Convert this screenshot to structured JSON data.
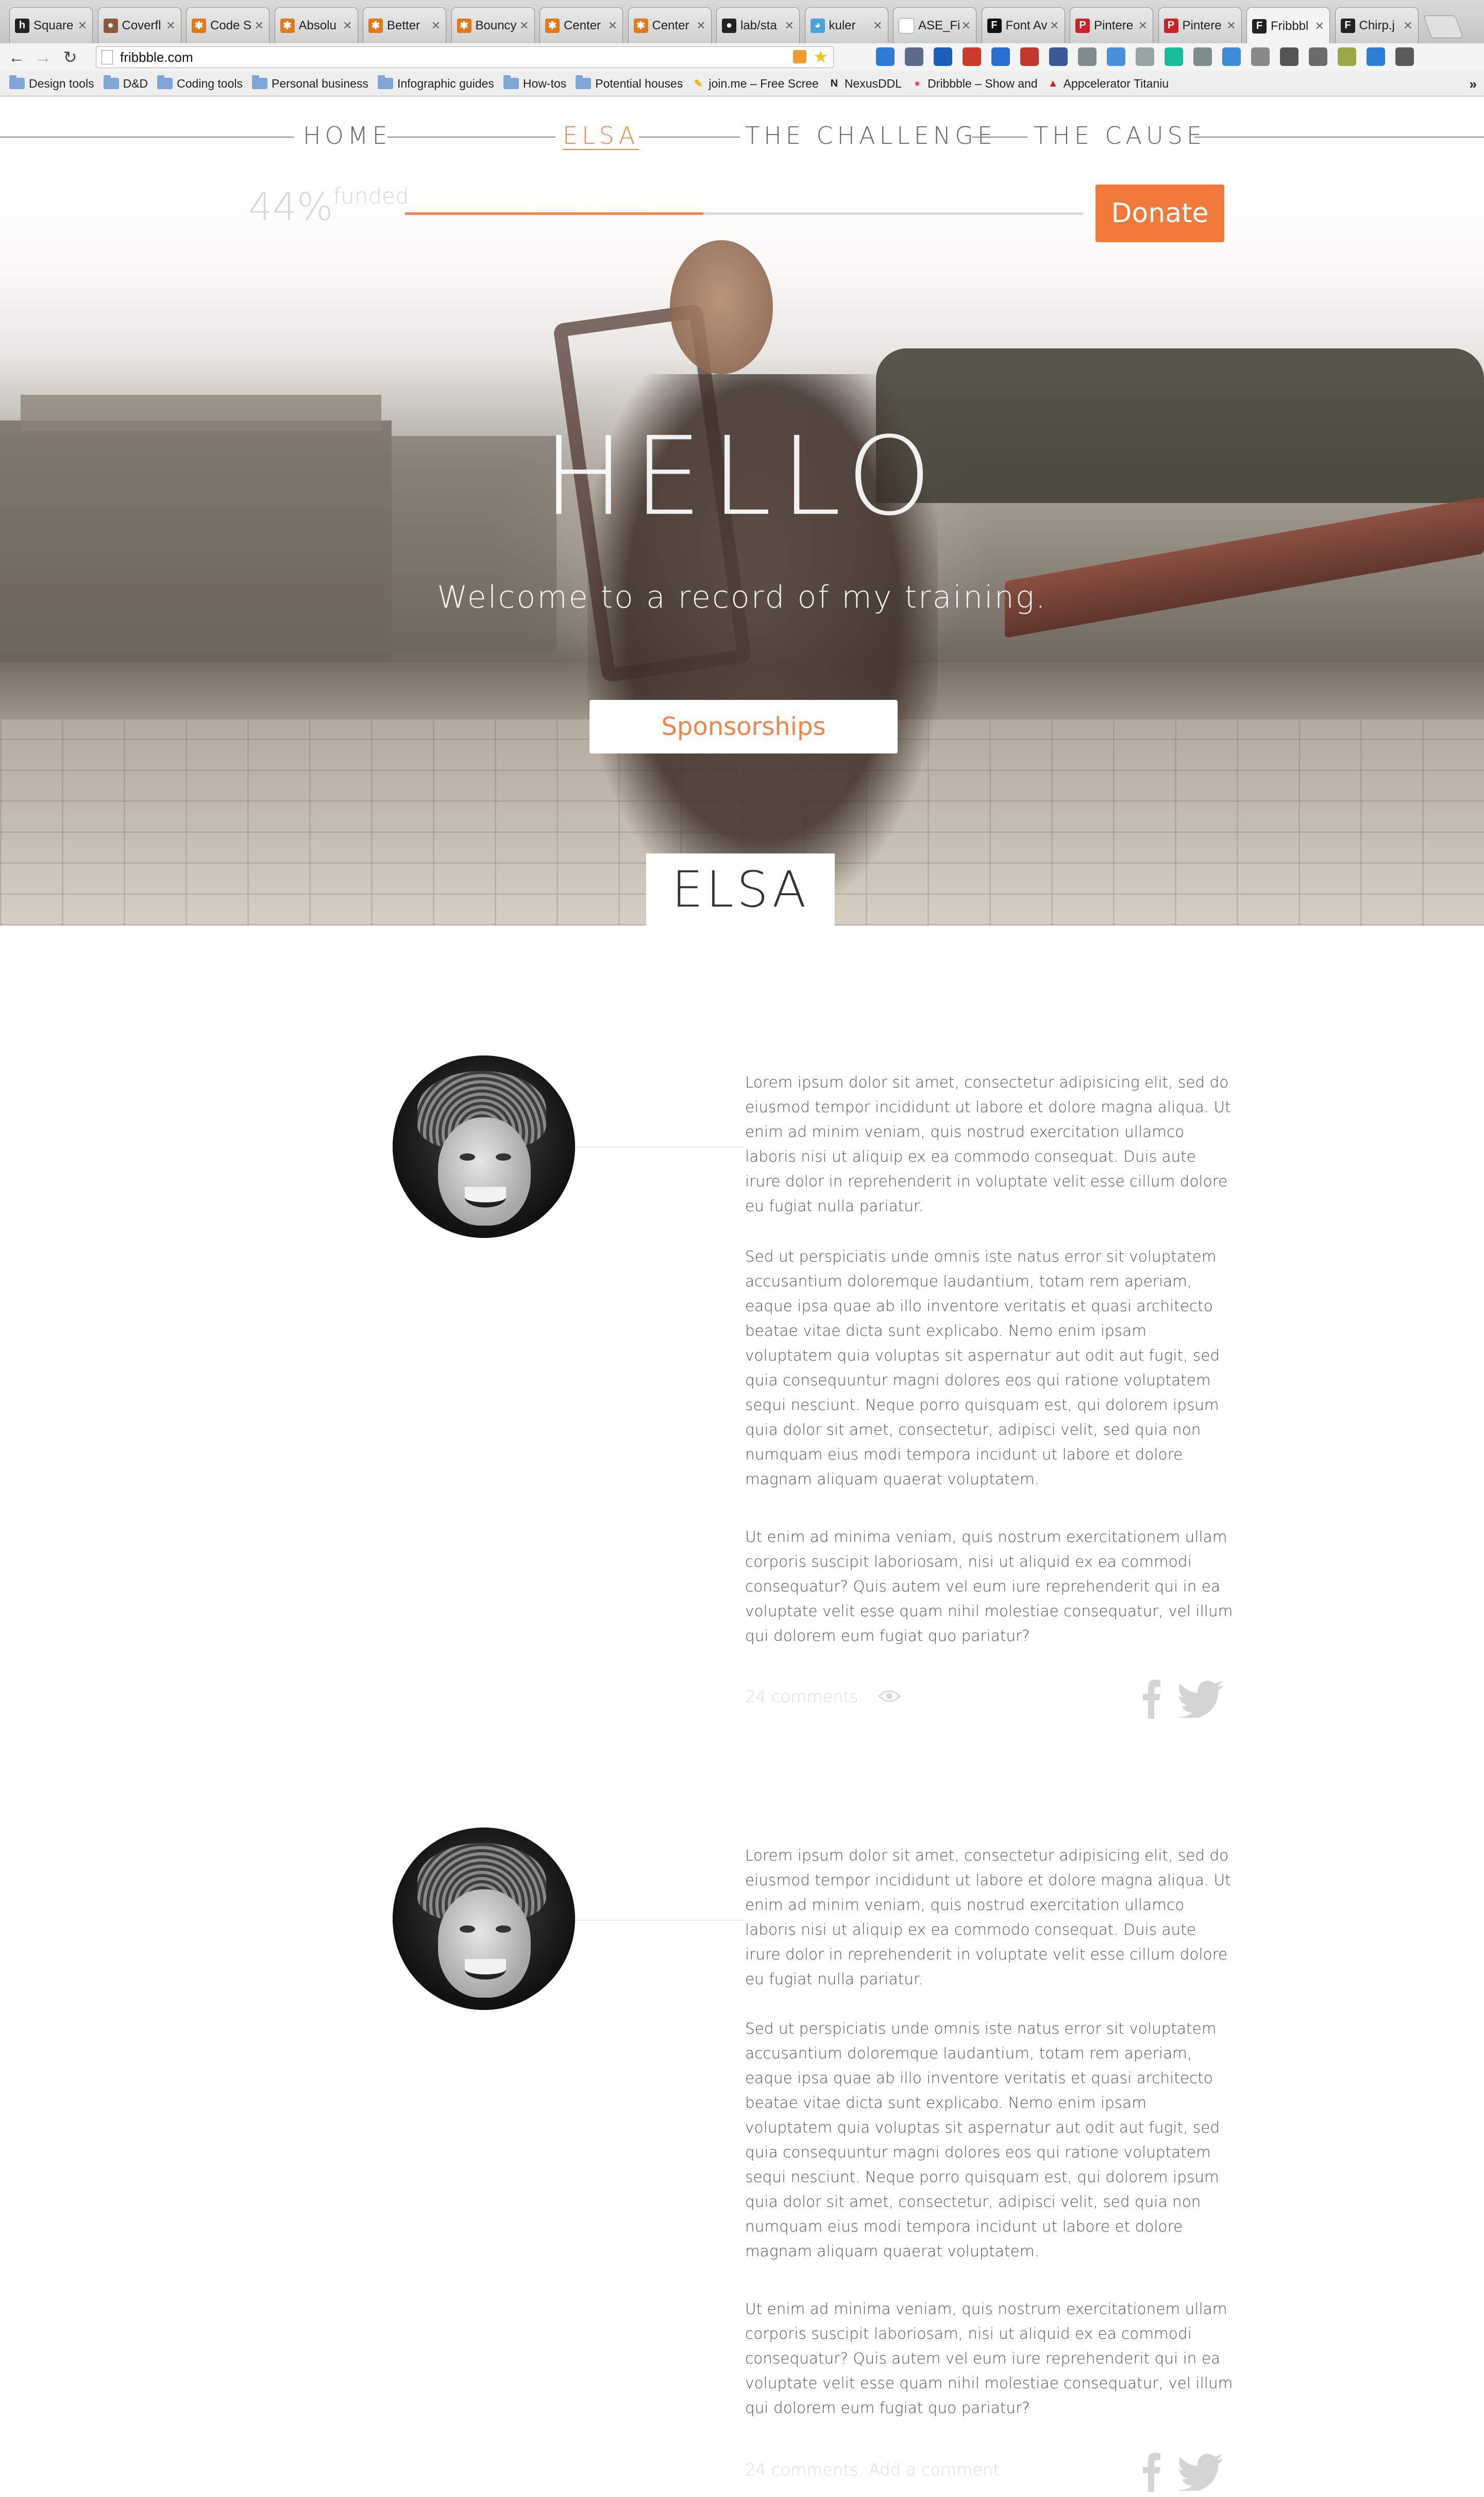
{
  "browser": {
    "tabs": [
      {
        "label": "Square",
        "icon": "h-icon",
        "color": "#222222"
      },
      {
        "label": "Coverfl",
        "icon": "avatar-icon",
        "color": "#8a5a3a"
      },
      {
        "label": "Code S",
        "icon": "asterisk-icon",
        "color": "#e07a1a"
      },
      {
        "label": "Absolu",
        "icon": "asterisk-icon",
        "color": "#e07a1a"
      },
      {
        "label": "Better",
        "icon": "asterisk-icon",
        "color": "#e07a1a"
      },
      {
        "label": "Bouncy",
        "icon": "asterisk-icon",
        "color": "#e07a1a"
      },
      {
        "label": "Center",
        "icon": "asterisk-icon",
        "color": "#e07a1a"
      },
      {
        "label": "Center",
        "icon": "asterisk-icon",
        "color": "#e07a1a"
      },
      {
        "label": "lab/sta",
        "icon": "github-icon",
        "color": "#222222"
      },
      {
        "label": "kuler",
        "icon": "kuler-icon",
        "color": "#4aa3df"
      },
      {
        "label": "ASE_Fil",
        "icon": "page-icon",
        "color": "#ffffff"
      },
      {
        "label": "Font Av",
        "icon": "font-icon",
        "color": "#111111"
      },
      {
        "label": "Pintere",
        "icon": "pinterest-icon",
        "color": "#cb2027"
      },
      {
        "label": "Pintere",
        "icon": "pinterest-icon",
        "color": "#cb2027"
      },
      {
        "label": "Fribbbl",
        "icon": "f-icon",
        "color": "#222222",
        "active": true
      },
      {
        "label": "Chirp.j",
        "icon": "f-icon",
        "color": "#222222"
      }
    ],
    "url": "fribbble.com",
    "bookmarks": [
      {
        "label": "Design tools",
        "type": "folder"
      },
      {
        "label": "D&D",
        "type": "folder"
      },
      {
        "label": "Coding tools",
        "type": "folder"
      },
      {
        "label": "Personal business",
        "type": "folder"
      },
      {
        "label": "Infographic guides",
        "type": "folder"
      },
      {
        "label": "How-tos",
        "type": "folder"
      },
      {
        "label": "Potential houses",
        "type": "folder"
      },
      {
        "label": "join.me – Free Scree",
        "type": "link",
        "icon": "joinme-icon",
        "color": "#f5b400"
      },
      {
        "label": "NexusDDL",
        "type": "link",
        "icon": "n-icon",
        "color": "#222222"
      },
      {
        "label": "Dribbble – Show and",
        "type": "link",
        "icon": "dribbble-icon",
        "color": "#ea4c89"
      },
      {
        "label": "Appcelerator Titaniu",
        "type": "link",
        "icon": "warning-icon",
        "color": "#cc2222"
      }
    ],
    "more": "»"
  },
  "nav": {
    "items": [
      {
        "label": "HOME",
        "current": false
      },
      {
        "label": "ELSA",
        "current": true
      },
      {
        "label": "THE CHALLENGE",
        "current": false
      },
      {
        "label": "THE CAUSE",
        "current": false
      }
    ]
  },
  "campaign": {
    "funded_percent": "44%",
    "funded_label": "funded",
    "progress": 0.44,
    "donate_label": "Donate",
    "accent": "#f2854a"
  },
  "hero": {
    "title": "HELLO",
    "subtitle": "Welcome to a record of my training.",
    "button_label": "Sponsorships",
    "name": "ELSA"
  },
  "posts": [
    {
      "paragraphs": [
        "Lorem ipsum dolor sit amet, consectetur adipisicing elit, sed do eiusmod tempor incididunt ut labore et dolore magna aliqua. Ut enim ad minim veniam, quis nostrud exercitation ullamco laboris nisi ut aliquip ex ea commodo consequat. Duis aute irure dolor in reprehenderit in voluptate velit esse cillum dolore eu fugiat nulla pariatur.",
        "Sed ut perspiciatis unde omnis iste natus error sit voluptatem accusantium doloremque laudantium, totam rem aperiam, eaque ipsa quae ab illo inventore veritatis et quasi architecto beatae vitae dicta sunt explicabo. Nemo enim ipsam voluptatem quia voluptas sit aspernatur aut odit aut fugit, sed quia consequuntur magni dolores eos qui ratione voluptatem sequi nesciunt. Neque porro quisquam est, qui dolorem ipsum quia dolor sit amet, consectetur, adipisci velit, sed quia non numquam eius modi tempora incidunt ut labore et dolore magnam aliquam quaerat voluptatem.",
        "Ut enim ad minima veniam, quis nostrum exercitationem ullam corporis suscipit laboriosam, nisi ut aliquid ex ea commodi consequatur? Quis autem vel eum iure reprehenderit qui in ea voluptate velit esse quam nihil molestiae consequatur, vel illum qui dolorem eum fugiat quo pariatur?"
      ],
      "comments": "24 comments."
    },
    {
      "paragraphs": [
        "Lorem ipsum dolor sit amet, consectetur adipisicing elit, sed do eiusmod tempor incididunt ut labore et dolore magna aliqua. Ut enim ad minim veniam, quis nostrud exercitation ullamco laboris nisi ut aliquip ex ea commodo consequat. Duis aute irure dolor in reprehenderit in voluptate velit esse cillum dolore eu fugiat nulla pariatur.",
        "Sed ut perspiciatis unde omnis iste natus error sit voluptatem accusantium doloremque laudantium, totam rem aperiam, eaque ipsa quae ab illo inventore veritatis et quasi architecto beatae vitae dicta sunt explicabo. Nemo enim ipsam voluptatem quia voluptas sit aspernatur aut odit aut fugit, sed quia consequuntur magni dolores eos qui ratione voluptatem sequi nesciunt. Neque porro quisquam est, qui dolorem ipsum quia dolor sit amet, consectetur, adipisci velit, sed quia non numquam eius modi tempora incidunt ut labore et dolore magnam aliquam quaerat voluptatem.",
        "Ut enim ad minima veniam, quis nostrum exercitationem ullam corporis suscipit laboriosam, nisi ut aliquid ex ea commodi consequatur? Quis autem vel eum iure reprehenderit qui in ea voluptate velit esse quam nihil molestiae consequatur, vel illum qui dolorem eum fugiat quo pariatur?"
      ],
      "comments": "24 comments. Add a comment"
    }
  ]
}
